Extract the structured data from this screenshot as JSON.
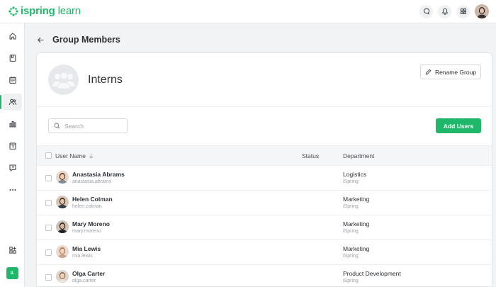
{
  "app": {
    "logo_text_bold": "ispring",
    "logo_text_light": "learn",
    "brand_color": "#1fb86b"
  },
  "topbar": {
    "icons": [
      "chat-icon",
      "bell-icon",
      "apps-grid-icon"
    ]
  },
  "sidebar": {
    "items": [
      "home-icon",
      "courses-icon",
      "calendar-icon",
      "users-icon",
      "reports-icon",
      "schedule-icon",
      "help-icon",
      "more-icon"
    ],
    "active": "users-icon",
    "bottom_icon": "add-widget-icon",
    "badge": "IL"
  },
  "page": {
    "title": "Group Members"
  },
  "group": {
    "name": "Interns",
    "rename_label": "Rename Group"
  },
  "toolbar": {
    "search_placeholder": "Search",
    "add_users_label": "Add Users"
  },
  "table": {
    "columns": {
      "user_name": "User Name",
      "status": "Status",
      "department": "Department"
    },
    "rows": [
      {
        "name": "Anastasia Abrams",
        "login": "anastasia.abrams",
        "status": "",
        "department": "Logistics",
        "org": "iSpring"
      },
      {
        "name": "Helen Colman",
        "login": "helen.colman",
        "status": "",
        "department": "Marketing",
        "org": "iSpring"
      },
      {
        "name": "Mary Moreno",
        "login": "mary.moreno",
        "status": "",
        "department": "Marketing",
        "org": "iSpring"
      },
      {
        "name": "Mia Lewis",
        "login": "mia.lewis",
        "status": "",
        "department": "Marketing",
        "org": "iSpring"
      },
      {
        "name": "Olga Carter",
        "login": "olga.carter",
        "status": "",
        "department": "Product Development",
        "org": "iSpring"
      }
    ]
  }
}
